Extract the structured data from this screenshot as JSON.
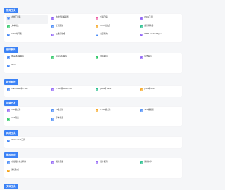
{
  "colors": {
    "accent": "#3b82f6",
    "background": "#f5f6f8"
  },
  "sections": [
    {
      "title": "常用工具",
      "items": [
        {
          "name": "在线工具箱",
          "desc": "",
          "icon": "toolbox-icon",
          "color": "#3b82f6"
        },
        {
          "name": "在线代码编辑器",
          "desc": "",
          "icon": "code-icon",
          "color": "#8b5cf6"
        },
        {
          "name": "代码压缩",
          "desc": "",
          "icon": "compress-icon",
          "color": "#ec4899"
        },
        {
          "name": "JSON工具",
          "desc": "",
          "icon": "braces-icon",
          "color": "#8b5cf6"
        },
        {
          "name": "文本对比",
          "desc": "",
          "icon": "diff-icon",
          "color": "#22c55e"
        },
        {
          "name": "正则测试",
          "desc": "",
          "icon": "regex-icon",
          "color": "#3b82f6"
        },
        {
          "name": "Cron表达式",
          "desc": "",
          "icon": "clock-icon",
          "color": "#f59e0b"
        },
        {
          "name": "颜色转换器",
          "desc": "",
          "icon": "palette-icon",
          "color": "#10b981"
        },
        {
          "name": "UNIX时间戳",
          "desc": "",
          "icon": "timestamp-icon",
          "color": "#3b82f6"
        },
        {
          "name": "二维码生成",
          "desc": "",
          "icon": "qrcode-icon",
          "color": "#8b5cf6"
        },
        {
          "name": "日历查询",
          "desc": "",
          "icon": "calendar-icon",
          "color": "#3b82f6"
        },
        {
          "name": "HTTP Content-Type",
          "desc": "",
          "icon": "http-icon",
          "color": "#8b5cf6"
        }
      ]
    },
    {
      "title": "编码解码",
      "items": [
        {
          "name": "Base64编解码",
          "desc": "",
          "icon": "base64-icon",
          "color": "#3b82f6"
        },
        {
          "name": "Unicode编码",
          "desc": "",
          "icon": "unicode-icon",
          "color": "#22c55e"
        },
        {
          "name": "URL编码",
          "desc": "",
          "icon": "url-icon",
          "color": "#22c55e"
        },
        {
          "name": "UTF编码",
          "desc": "",
          "icon": "utf-icon",
          "color": "#8b5cf6"
        },
        {
          "name": "Hash",
          "desc": "",
          "icon": "hash-icon",
          "color": "#3b82f6"
        }
      ]
    },
    {
      "title": "格式转换",
      "items": [
        {
          "name": "Markdown转HTML",
          "desc": "",
          "icon": "markdown-icon",
          "color": "#3b82f6"
        },
        {
          "name": "HTML转JavaScript",
          "desc": "",
          "icon": "html-icon",
          "color": "#8b5cf6"
        },
        {
          "name": "JSON转YAML",
          "desc": "",
          "icon": "json-icon",
          "color": "#10b981"
        },
        {
          "name": "JSON转XML",
          "desc": "",
          "icon": "xml-icon",
          "color": "#f59e0b"
        }
      ]
    },
    {
      "title": "前端开发",
      "items": [
        {
          "name": "CSS格式化",
          "desc": "",
          "icon": "css-icon",
          "color": "#8b5cf6"
        },
        {
          "name": "JS格式化",
          "desc": "",
          "icon": "js-icon",
          "color": "#3b82f6"
        },
        {
          "name": "HTML格式化",
          "desc": "",
          "icon": "format-icon",
          "color": "#f59e0b"
        },
        {
          "name": "SVG编辑器",
          "desc": "",
          "icon": "svg-icon",
          "color": "#3b82f6"
        },
        {
          "name": "CSS渐变",
          "desc": "",
          "icon": "gradient-icon",
          "color": "#22c55e"
        },
        {
          "name": "字体预览",
          "desc": "",
          "icon": "font-icon",
          "color": "#3b82f6"
        }
      ]
    },
    {
      "title": "网络工具",
      "items": [
        {
          "name": "Websocket工具",
          "desc": "",
          "icon": "socket-icon",
          "color": "#3b82f6"
        }
      ]
    },
    {
      "title": "图片处理",
      "items": [
        {
          "name": "在线图片格式转换",
          "desc": "",
          "icon": "image-convert-icon",
          "color": "#3b82f6"
        },
        {
          "name": "图片压缩",
          "desc": "",
          "icon": "image-compress-icon",
          "color": "#8b5cf6"
        },
        {
          "name": "图片裁剪",
          "desc": "",
          "icon": "crop-icon",
          "color": "#8b5cf6"
        },
        {
          "name": "图片水印",
          "desc": "",
          "icon": "watermark-icon",
          "color": "#10b981"
        },
        {
          "name": "图标生成",
          "desc": "",
          "icon": "favicon-icon",
          "color": "#f59e0b"
        }
      ]
    },
    {
      "title": "文本工具",
      "items": []
    }
  ]
}
